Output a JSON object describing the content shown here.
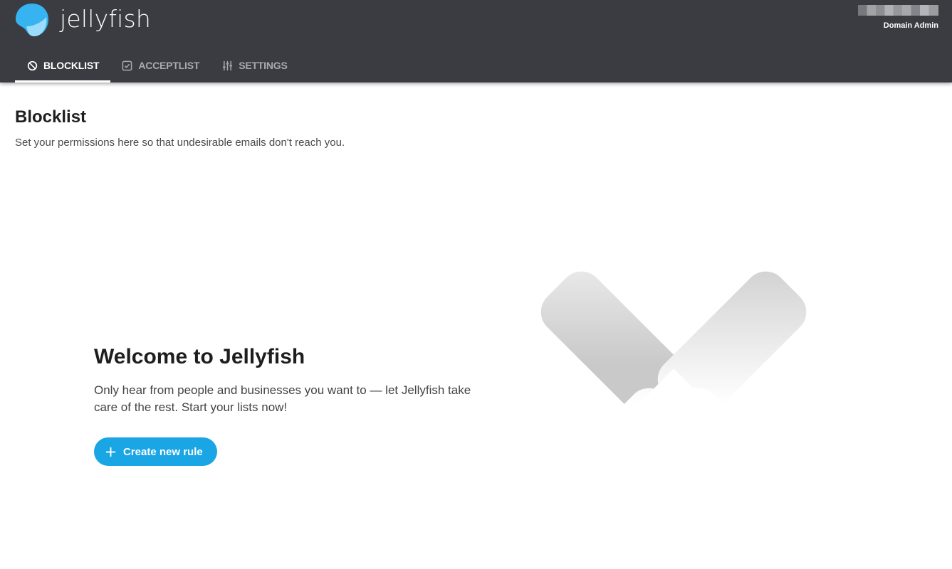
{
  "app": {
    "name": "jellyfish",
    "logo_icon": "jellyfish-logo-icon"
  },
  "user": {
    "name": "[redacted]",
    "role": "Domain Admin"
  },
  "tabs": [
    {
      "label": "BLOCKLIST",
      "icon": "block-icon",
      "active": true
    },
    {
      "label": "ACCEPTLIST",
      "icon": "checkbox-icon",
      "active": false
    },
    {
      "label": "SETTINGS",
      "icon": "sliders-icon",
      "active": false
    }
  ],
  "page": {
    "title": "Blocklist",
    "subtitle": "Set your permissions here so that undesirable emails don't reach you."
  },
  "welcome": {
    "title": "Welcome to Jellyfish",
    "text": "Only hear from people and businesses you want to — let Jellyfish take care of the rest. Start your lists now!",
    "button_label": "Create new rule",
    "button_icon": "plus-icon"
  },
  "colors": {
    "header_bg": "#3b3c41",
    "accent": "#1aa5e5",
    "text_dark": "#1e1e1e"
  }
}
